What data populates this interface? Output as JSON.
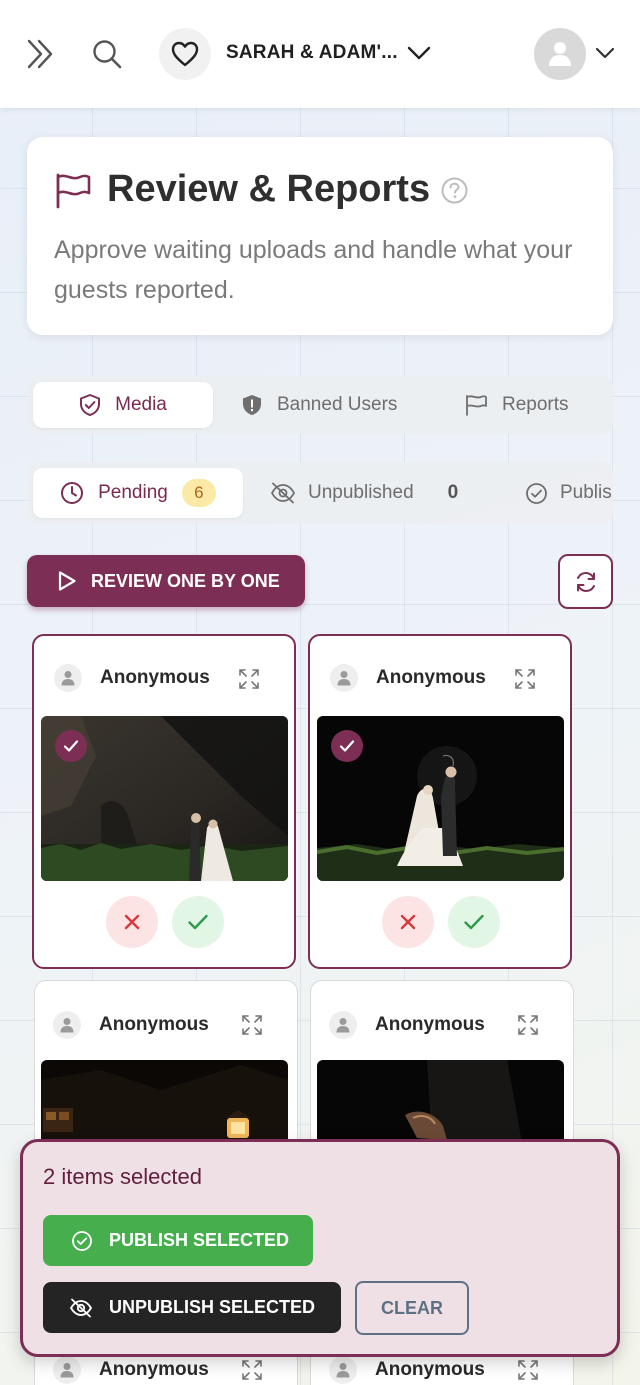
{
  "header": {
    "event_title": "SARAH & ADAM'...",
    "icons": [
      "double-chevron-right-icon",
      "search-icon",
      "heart-icon",
      "chevron-down-icon",
      "user-avatar-icon"
    ]
  },
  "hero": {
    "title": "Review & Reports",
    "description": "Approve waiting uploads and handle what your guests reported."
  },
  "main_tabs": [
    {
      "label": "Media",
      "icon": "shield-check-icon",
      "active": true
    },
    {
      "label": "Banned Users",
      "icon": "shield-alert-icon",
      "active": false
    },
    {
      "label": "Reports",
      "icon": "flag-icon",
      "active": false
    }
  ],
  "status_tabs": [
    {
      "label": "Pending",
      "count": "6",
      "icon": "clock-icon",
      "active": true
    },
    {
      "label": "Unpublished",
      "count": "0",
      "icon": "eye-off-icon",
      "active": false
    },
    {
      "label": "Publis",
      "icon": "check-circle-icon",
      "active": false
    }
  ],
  "actions": {
    "review_one_by_one": "REVIEW ONE BY ONE"
  },
  "cards": [
    {
      "name": "Anonymous",
      "selected": true
    },
    {
      "name": "Anonymous",
      "selected": true
    },
    {
      "name": "Anonymous",
      "selected": false
    },
    {
      "name": "Anonymous",
      "selected": false
    },
    {
      "name": "Anonymous",
      "selected": false
    },
    {
      "name": "Anonymous",
      "selected": false
    }
  ],
  "selection": {
    "count_text": "2 items selected",
    "publish_label": "PUBLISH SELECTED",
    "unpublish_label": "UNPUBLISH SELECTED",
    "clear_label": "CLEAR"
  },
  "colors": {
    "brand": "#7d2e55",
    "publish": "#47ae4d",
    "dark_button": "#242424",
    "badge_bg": "#fbe9a8"
  }
}
